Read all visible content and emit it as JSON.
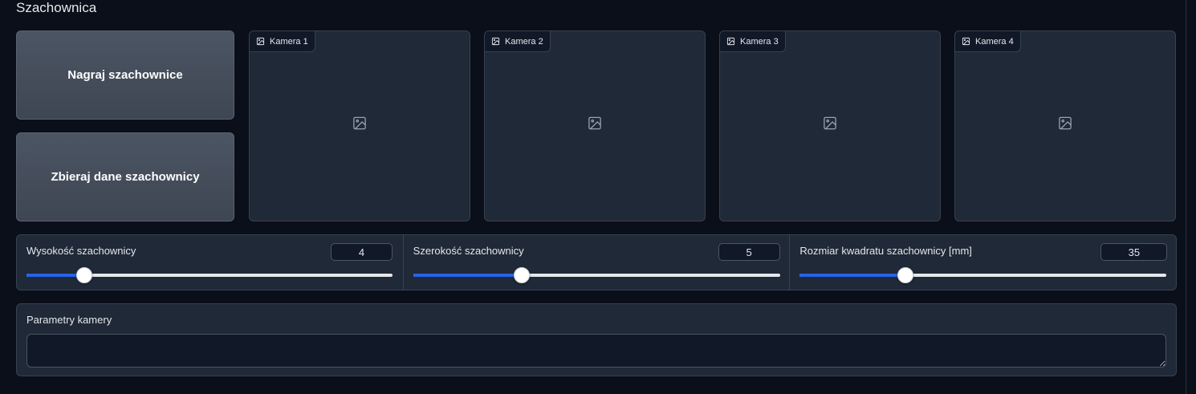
{
  "section": {
    "title": "Szachownica"
  },
  "buttons": {
    "record_label": "Nagraj szachownice",
    "collect_label": "Zbieraj dane szachownicy"
  },
  "cameras": [
    {
      "label": "Kamera 1",
      "icon": "image-icon"
    },
    {
      "label": "Kamera 2",
      "icon": "image-icon"
    },
    {
      "label": "Kamera 3",
      "icon": "image-icon"
    },
    {
      "label": "Kamera 4",
      "icon": "image-icon"
    }
  ],
  "sliders": [
    {
      "label": "Wysokość szachownicy",
      "value": "4",
      "fraction": 0.157
    },
    {
      "label": "Szerokość szachownicy",
      "value": "5",
      "fraction": 0.296
    },
    {
      "label": "Rozmiar kwadratu szachownicy [mm]",
      "value": "35",
      "fraction": 0.287
    }
  ],
  "params": {
    "label": "Parametry kamery",
    "value": ""
  },
  "colors": {
    "accent": "#2563eb",
    "background": "#0b0f19",
    "panel": "#1f2937"
  }
}
